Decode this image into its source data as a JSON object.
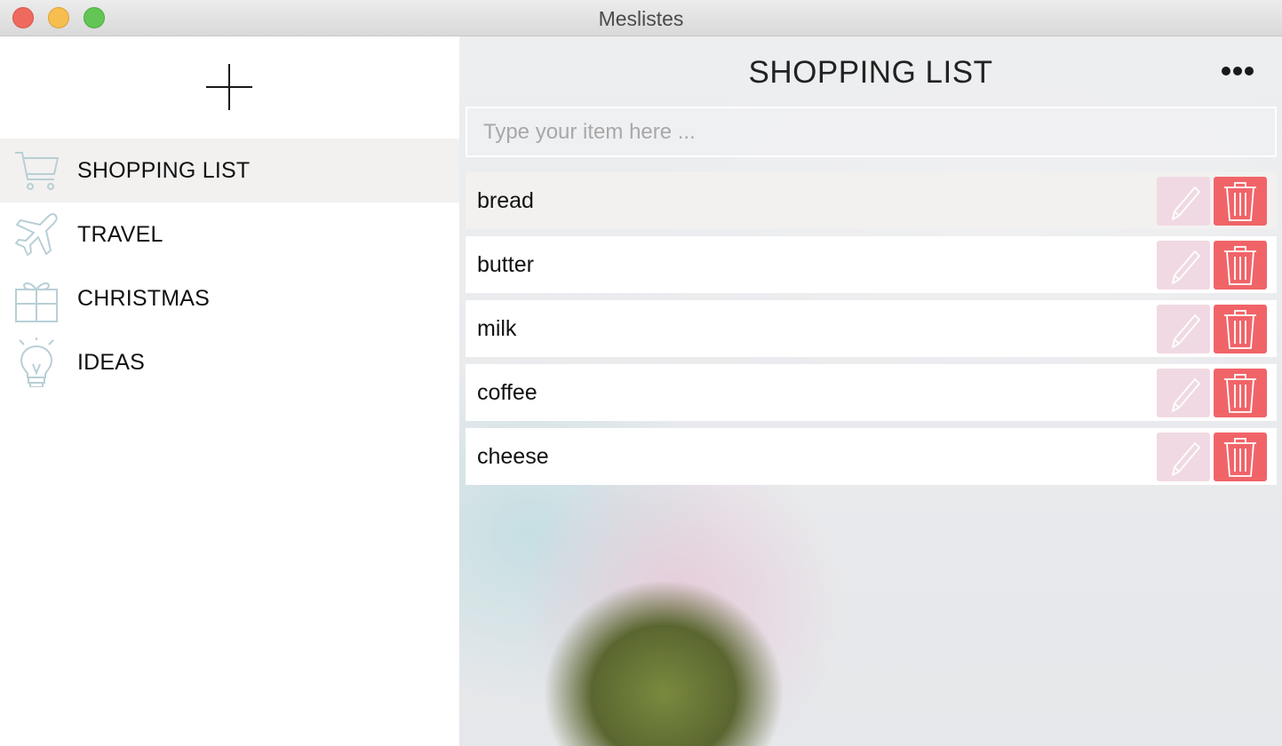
{
  "window": {
    "title": "Meslistes"
  },
  "sidebar": {
    "items": [
      {
        "label": "SHOPPING LIST",
        "icon": "shopping-cart-icon",
        "active": true
      },
      {
        "label": "TRAVEL",
        "icon": "airplane-icon",
        "active": false
      },
      {
        "label": "CHRISTMAS",
        "icon": "gift-icon",
        "active": false
      },
      {
        "label": "IDEAS",
        "icon": "lightbulb-icon",
        "active": false
      }
    ]
  },
  "main": {
    "title": "SHOPPING LIST",
    "input_placeholder": "Type your item here ...",
    "items": [
      "bread",
      "butter",
      "milk",
      "coffee",
      "cheese"
    ]
  },
  "colors": {
    "accent_icon": "#b9cfd6",
    "delete": "#f06468",
    "edit": "#f0d9e2",
    "active_row": "#f2f1f0"
  }
}
